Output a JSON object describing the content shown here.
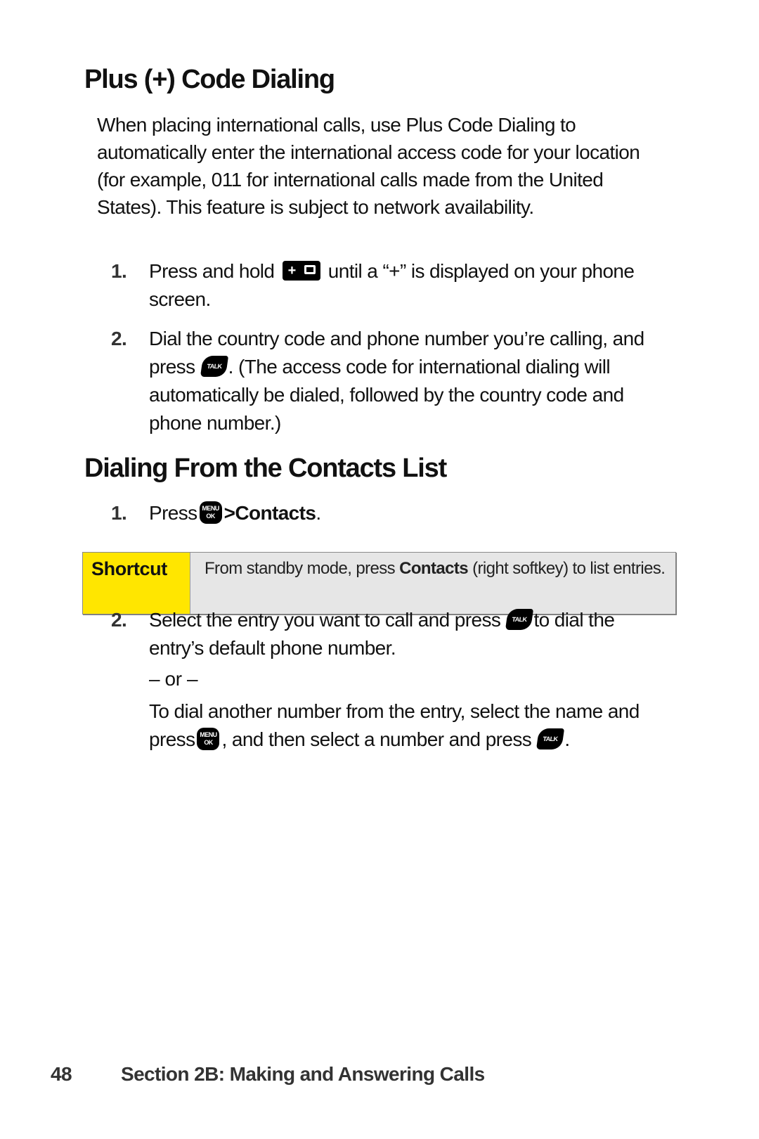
{
  "section1": {
    "title": "Plus (+) Code Dialing",
    "intro": "When placing international calls, use Plus Code Dialing to automatically enter the international access code for your location (for example, 011 for international calls made from the United States). This feature is subject to network availability.",
    "steps": [
      {
        "num": "1.",
        "before": "Press and hold",
        "key": "plus-zero-key",
        "key_label": "+",
        "after": "until a “+” is displayed on your phone screen."
      },
      {
        "num": "2.",
        "before": "Dial the country code and phone number you’re calling, and press",
        "key": "talk-key",
        "key_label": "TALK",
        "after": ". (The access code for international dialing will automatically be dialed, followed by the country code and phone number.)"
      }
    ]
  },
  "section2": {
    "title": "Dialing From the Contacts List",
    "step1": {
      "num": "1.",
      "before": "Press",
      "key_label_top": "MENU",
      "key_label_bottom": "OK",
      "separator": ">",
      "target": "Contacts",
      "after": "."
    },
    "shortcut": {
      "label": "Shortcut",
      "before": "From standby mode, press",
      "bold": "Contacts",
      "after": "(right softkey) to list entries."
    },
    "step2": {
      "num": "2.",
      "before": "Select the entry you want to call and press",
      "key_label": "TALK",
      "after": "to dial the entry’s default phone number.",
      "or": "– or –",
      "alt_before": "To dial another number from the entry, select the name and press",
      "alt_menu_top": "MENU",
      "alt_menu_bottom": "OK",
      "alt_middle": ", and then select a number and press",
      "alt_talk": "TALK",
      "alt_after": "."
    }
  },
  "footer": {
    "page_number": "48",
    "section": "Section 2B: Making and Answering Calls"
  },
  "colors": {
    "shortcut_label_bg": "#ffe600",
    "shortcut_body_bg": "#e6e6e6"
  }
}
